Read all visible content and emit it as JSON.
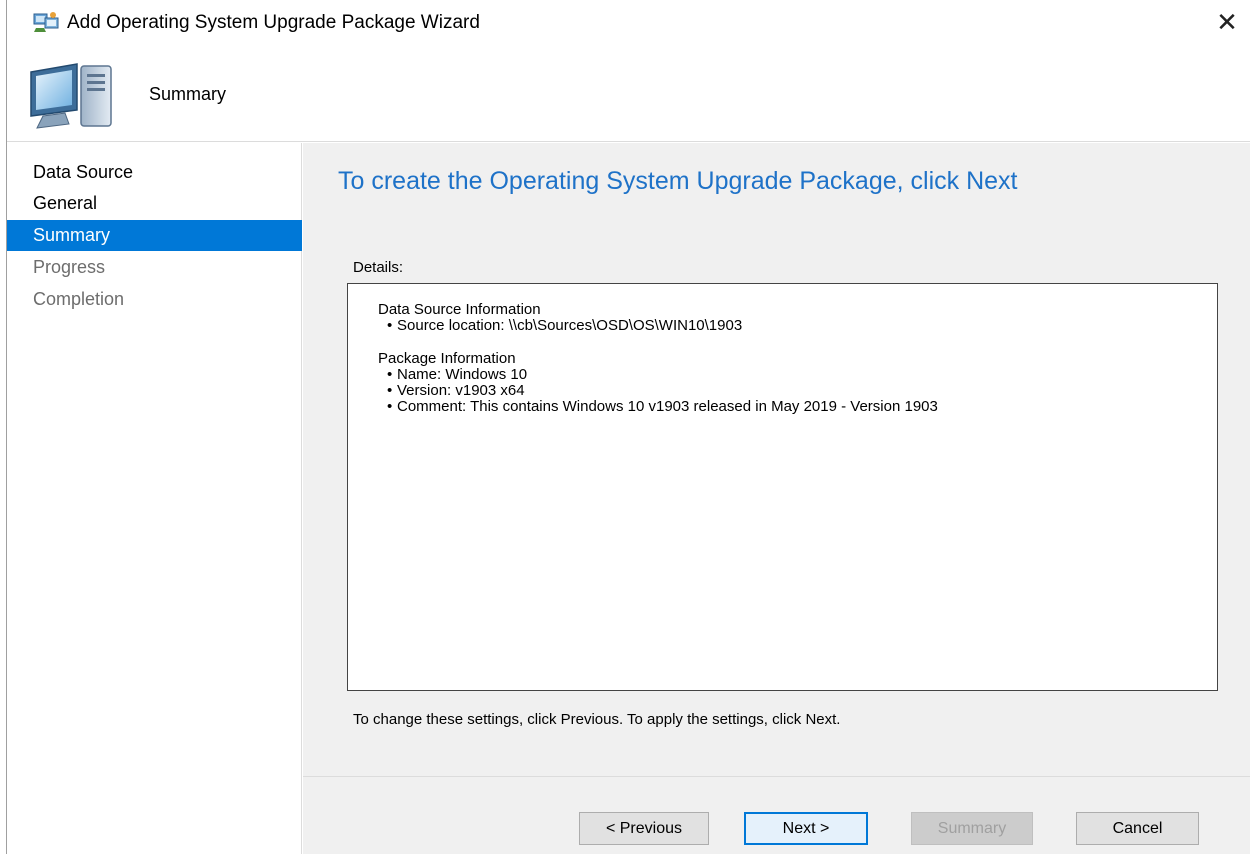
{
  "window": {
    "title": "Add Operating System Upgrade Package Wizard",
    "close_glyph": "✕"
  },
  "header": {
    "page_title": "Summary",
    "icon": "computer-wizard-icon"
  },
  "nav": {
    "items": [
      {
        "label": "Data Source",
        "state": "normal"
      },
      {
        "label": "General",
        "state": "normal"
      },
      {
        "label": "Summary",
        "state": "active"
      },
      {
        "label": "Progress",
        "state": "disabled"
      },
      {
        "label": "Completion",
        "state": "disabled"
      }
    ]
  },
  "main": {
    "heading": "To create the Operating System Upgrade Package, click Next",
    "details_label": "Details:",
    "details": {
      "data_source": {
        "title": "Data Source Information",
        "items": [
          "Source location: \\\\cb\\Sources\\OSD\\OS\\WIN10\\1903"
        ]
      },
      "package": {
        "title": "Package Information",
        "items": [
          "Name: Windows 10",
          "Version: v1903 x64",
          "Comment: This contains Windows 10 v1903 released in May 2019 - Version 1903"
        ]
      }
    },
    "hint": "To change these settings, click Previous. To apply the settings, click Next."
  },
  "buttons": {
    "previous": "< Previous",
    "next": "Next >",
    "summary": "Summary",
    "cancel": "Cancel"
  },
  "colors": {
    "accent": "#0078d7",
    "heading": "#1e72c8",
    "panel": "#f0f0f0"
  }
}
